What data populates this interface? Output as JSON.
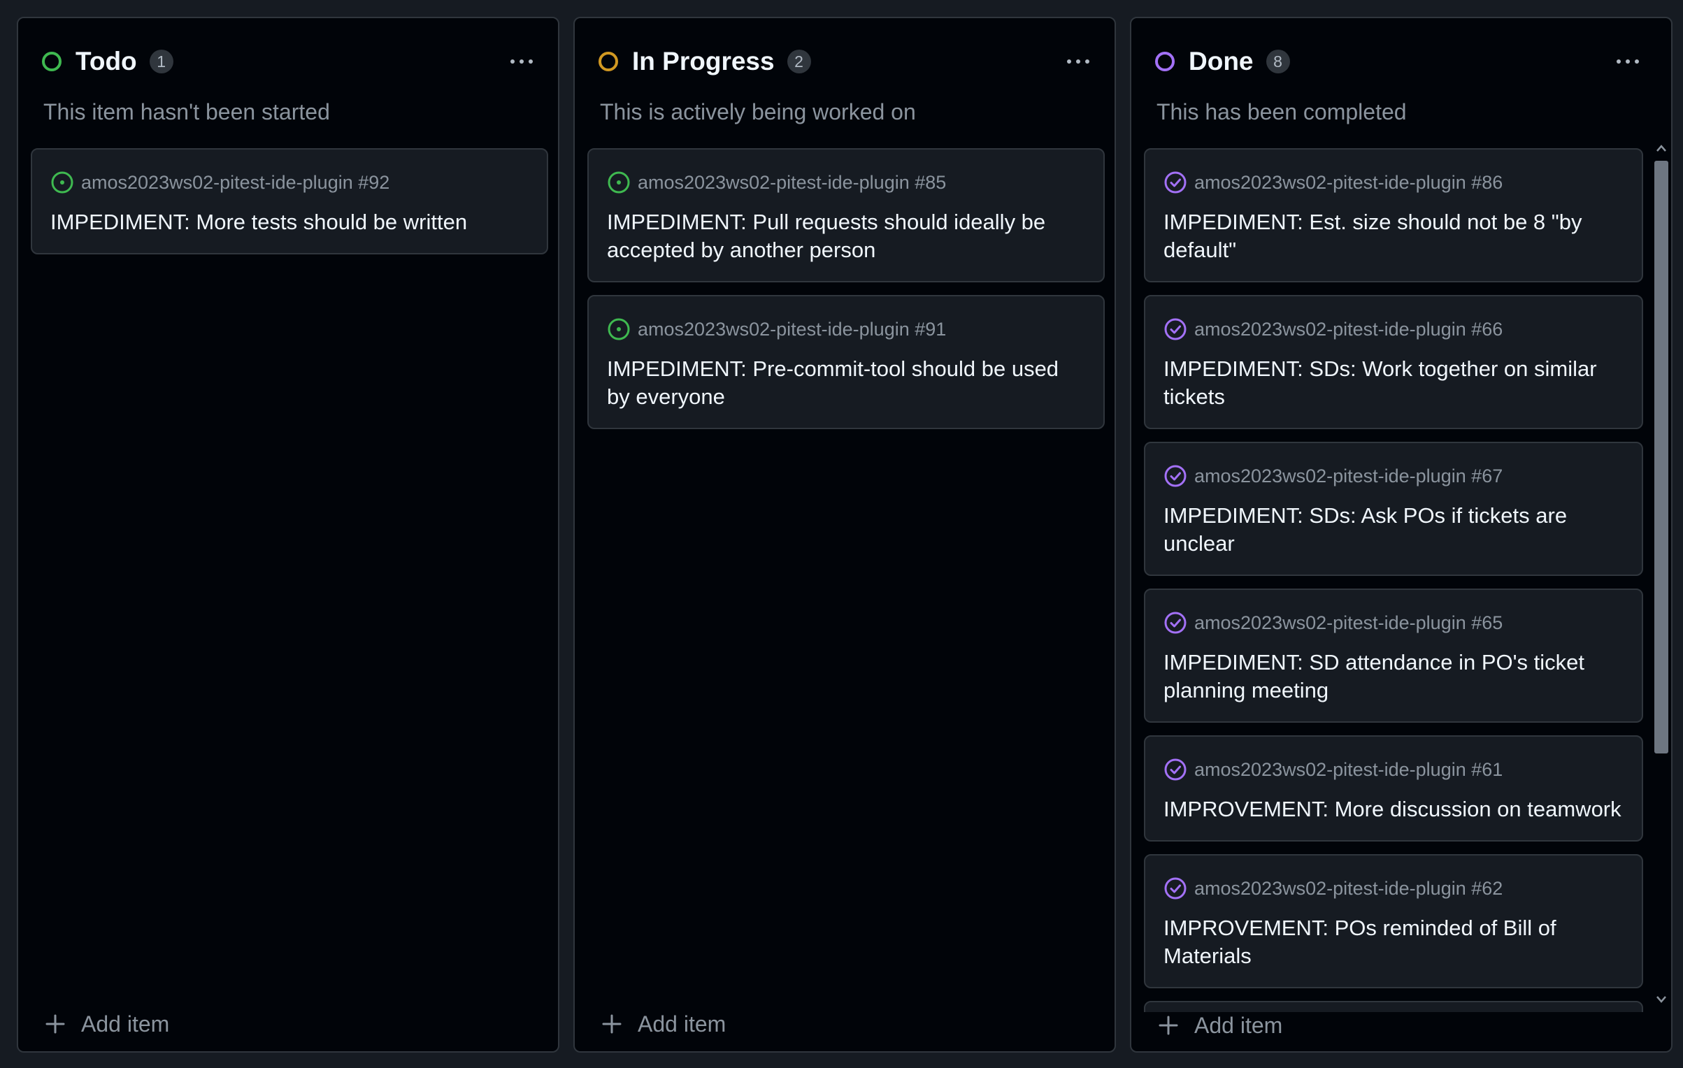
{
  "colors": {
    "todo": "#3fb950",
    "in_progress": "#d29922",
    "done": "#a371f7",
    "open_issue": "#3fb950",
    "closed_issue": "#a371f7"
  },
  "columns": [
    {
      "title": "Todo",
      "count": "1",
      "description": "This item hasn't been started",
      "status_icon": "circle-outline-green-icon",
      "add_item_label": "Add item",
      "cards": [
        {
          "repo": "amos2023ws02-pitest-ide-plugin #92",
          "title": "IMPEDIMENT: More tests should be written",
          "icon": "issue-opened-icon"
        }
      ]
    },
    {
      "title": "In Progress",
      "count": "2",
      "description": "This is actively being worked on",
      "status_icon": "circle-outline-orange-icon",
      "add_item_label": "Add item",
      "cards": [
        {
          "repo": "amos2023ws02-pitest-ide-plugin #85",
          "title": "IMPEDIMENT: Pull requests should ideally be accepted by another person",
          "icon": "issue-opened-icon"
        },
        {
          "repo": "amos2023ws02-pitest-ide-plugin #91",
          "title": "IMPEDIMENT: Pre-commit-tool should be used by everyone",
          "icon": "issue-opened-icon"
        }
      ]
    },
    {
      "title": "Done",
      "count": "8",
      "description": "This has been completed",
      "status_icon": "circle-outline-purple-icon",
      "add_item_label": "Add item",
      "cards": [
        {
          "repo": "amos2023ws02-pitest-ide-plugin #86",
          "title": "IMPEDIMENT: Est. size should not be 8 \"by default\"",
          "icon": "issue-closed-icon"
        },
        {
          "repo": "amos2023ws02-pitest-ide-plugin #66",
          "title": "IMPEDIMENT: SDs: Work together on similar tickets",
          "icon": "issue-closed-icon"
        },
        {
          "repo": "amos2023ws02-pitest-ide-plugin #67",
          "title": "IMPEDIMENT: SDs: Ask POs if tickets are unclear",
          "icon": "issue-closed-icon"
        },
        {
          "repo": "amos2023ws02-pitest-ide-plugin #65",
          "title": "IMPEDIMENT: SD attendance in PO's ticket planning meeting",
          "icon": "issue-closed-icon"
        },
        {
          "repo": "amos2023ws02-pitest-ide-plugin #61",
          "title": "IMPROVEMENT: More discussion on teamwork",
          "icon": "issue-closed-icon"
        },
        {
          "repo": "amos2023ws02-pitest-ide-plugin #62",
          "title": "IMPROVEMENT: POs reminded of Bill of Materials",
          "icon": "issue-closed-icon"
        }
      ]
    }
  ]
}
